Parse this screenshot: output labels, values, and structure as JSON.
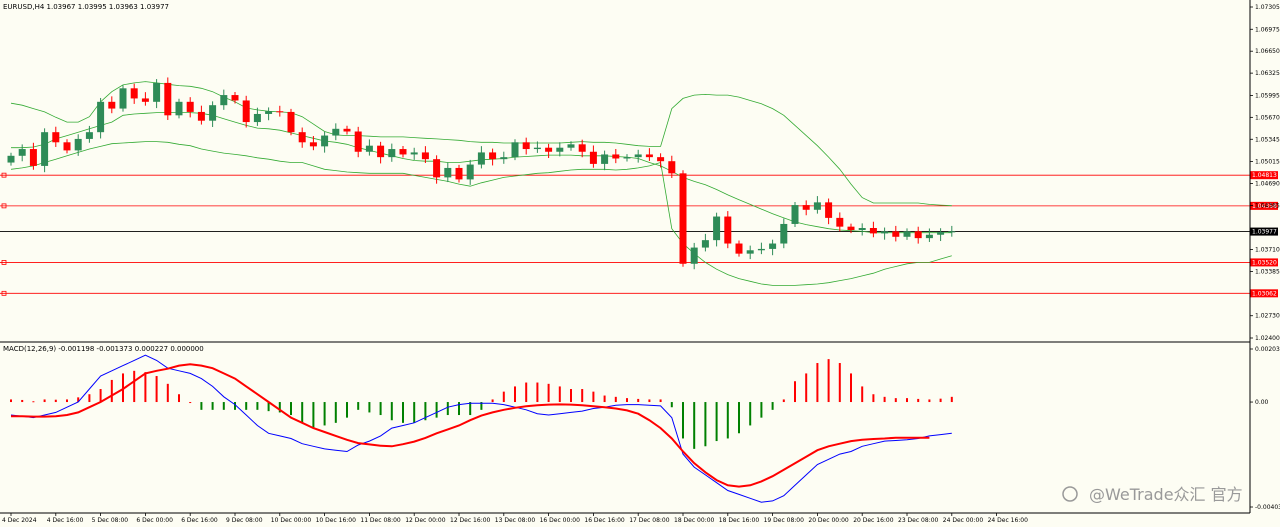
{
  "chart_data": [
    {
      "type": "candlestick",
      "symbol_header": "EURUSD,H4  1.03967 1.03995 1.03963 1.03977",
      "indicator": "Bollinger Bands",
      "ylim": [
        1.024,
        1.07305
      ],
      "y_ticks": [
        "1.07305",
        "1.06975",
        "1.06650",
        "1.06325",
        "1.05995",
        "1.05670",
        "1.05345",
        "1.05015",
        "1.04690",
        "1.04365",
        "1.03710",
        "1.03385",
        "1.02730",
        "1.02400"
      ],
      "x_ticks": [
        "4 Dec 2024",
        "4 Dec 16:00",
        "5 Dec 08:00",
        "6 Dec 00:00",
        "6 Dec 16:00",
        "9 Dec 08:00",
        "10 Dec 00:00",
        "10 Dec 16:00",
        "11 Dec 08:00",
        "12 Dec 00:00",
        "12 Dec 16:00",
        "13 Dec 08:00",
        "16 Dec 00:00",
        "16 Dec 16:00",
        "17 Dec 08:00",
        "18 Dec 00:00",
        "18 Dec 16:00",
        "19 Dec 08:00",
        "20 Dec 00:00",
        "20 Dec 16:00",
        "23 Dec 08:00",
        "24 Dec 00:00",
        "24 Dec 16:00"
      ],
      "current_price": "1.03977",
      "levels": [
        {
          "label": "1.04813",
          "value": 1.04813
        },
        {
          "label": "1.04358",
          "value": 1.04358
        },
        {
          "label": "1.03520",
          "value": 1.0352
        },
        {
          "label": "1.03062",
          "value": 1.03062
        }
      ],
      "colors": {
        "bull": "#2e8b57",
        "bear": "#ff0000",
        "band": "#33aa33",
        "level": "#ff0000",
        "current": "#000000"
      },
      "close": [
        1.051,
        1.052,
        1.0495,
        1.0545,
        1.053,
        1.0518,
        1.0535,
        1.0545,
        1.059,
        1.058,
        1.061,
        1.0595,
        1.059,
        1.0618,
        1.057,
        1.059,
        1.0575,
        1.0562,
        1.0585,
        1.06,
        1.0592,
        1.056,
        1.0572,
        1.0576,
        1.0575,
        1.0545,
        1.053,
        1.0524,
        1.054,
        1.055,
        1.0546,
        1.0516,
        1.0525,
        1.0508,
        1.052,
        1.0512,
        1.0515,
        1.0505,
        1.0478,
        1.0492,
        1.0475,
        1.0497,
        1.0515,
        1.0505,
        1.0508,
        1.053,
        1.052,
        1.0522,
        1.0516,
        1.0522,
        1.0527,
        1.0516,
        1.0498,
        1.0512,
        1.0506,
        1.0508,
        1.0512,
        1.0508,
        1.0502,
        1.0484,
        1.035,
        1.0374,
        1.0385,
        1.042,
        1.038,
        1.0365,
        1.037,
        1.0372,
        1.038,
        1.0409,
        1.0437,
        1.043,
        1.0441,
        1.0418,
        1.0405,
        1.04,
        1.0403,
        1.0395,
        1.0398,
        1.039,
        1.0398,
        1.0388,
        1.0393,
        1.0397,
        1.0398
      ],
      "bb_upper": [
        1.0588,
        1.0585,
        1.058,
        1.0575,
        1.0567,
        1.056,
        1.056,
        1.0568,
        1.059,
        1.0605,
        1.0615,
        1.0618,
        1.062,
        1.0618,
        1.0616,
        1.0614,
        1.0613,
        1.061,
        1.0605,
        1.0597,
        1.059,
        1.0581,
        1.0578,
        1.0576,
        1.0575,
        1.0574,
        1.0568,
        1.0557,
        1.0546,
        1.0541,
        1.054,
        1.054,
        1.0539,
        1.0538,
        1.0538,
        1.0538,
        1.0537,
        1.0536,
        1.0535,
        1.0534,
        1.0533,
        1.0531,
        1.053,
        1.053,
        1.0529,
        1.0529,
        1.0529,
        1.0529,
        1.0529,
        1.0529,
        1.053,
        1.0531,
        1.053,
        1.053,
        1.0529,
        1.0527,
        1.0525,
        1.0524,
        1.0524,
        1.058,
        1.0595,
        1.06,
        1.0601,
        1.06,
        1.06,
        1.0597,
        1.0592,
        1.0587,
        1.058,
        1.057,
        1.0555,
        1.054,
        1.0525,
        1.0508,
        1.049,
        1.0468,
        1.0448,
        1.044,
        1.044,
        1.044,
        1.044,
        1.044,
        1.0438,
        1.0437,
        1.0436
      ],
      "bb_middle": [
        1.0522,
        1.0522,
        1.0523,
        1.0527,
        1.0535,
        1.054,
        1.0545,
        1.055,
        1.0555,
        1.056,
        1.057,
        1.0572,
        1.0573,
        1.0574,
        1.0574,
        1.0574,
        1.0574,
        1.0573,
        1.057,
        1.0565,
        1.056,
        1.0555,
        1.0551,
        1.055,
        1.0548,
        1.0544,
        1.054,
        1.0536,
        1.0532,
        1.053,
        1.0527,
        1.0522,
        1.0518,
        1.0514,
        1.051,
        1.0506,
        1.0503,
        1.0502,
        1.0502,
        1.05,
        1.05,
        1.0502,
        1.0504,
        1.0505,
        1.0506,
        1.0508,
        1.0509,
        1.051,
        1.0511,
        1.0511,
        1.0511,
        1.051,
        1.051,
        1.051,
        1.0509,
        1.0508,
        1.0506,
        1.05,
        1.0495,
        1.0487,
        1.0478,
        1.0472,
        1.0467,
        1.046,
        1.0452,
        1.0445,
        1.0438,
        1.0431,
        1.0424,
        1.0418,
        1.0412,
        1.0408,
        1.0405,
        1.0402,
        1.04,
        1.0399,
        1.0398,
        1.0396,
        1.0396,
        1.0396,
        1.0396,
        1.0396,
        1.0396,
        1.0396,
        1.0396
      ],
      "bb_lower": [
        1.049,
        1.0492,
        1.0495,
        1.05,
        1.0505,
        1.051,
        1.0515,
        1.052,
        1.0524,
        1.0528,
        1.0529,
        1.053,
        1.0531,
        1.0531,
        1.053,
        1.0527,
        1.0525,
        1.052,
        1.0517,
        1.0514,
        1.0512,
        1.051,
        1.0507,
        1.0505,
        1.0502,
        1.05,
        1.05,
        1.0495,
        1.049,
        1.0488,
        1.0486,
        1.0485,
        1.0484,
        1.0484,
        1.0484,
        1.0484,
        1.0481,
        1.0478,
        1.0475,
        1.0472,
        1.0468,
        1.0465,
        1.047,
        1.0474,
        1.0478,
        1.048,
        1.0482,
        1.0484,
        1.0485,
        1.0487,
        1.0489,
        1.049,
        1.049,
        1.049,
        1.0489,
        1.049,
        1.0492,
        1.0495,
        1.05,
        1.0402,
        1.038,
        1.0365,
        1.0352,
        1.0342,
        1.0334,
        1.0328,
        1.0324,
        1.032,
        1.0318,
        1.0318,
        1.0318,
        1.0319,
        1.032,
        1.0322,
        1.0325,
        1.0328,
        1.0332,
        1.0336,
        1.0342,
        1.0346,
        1.035,
        1.0352,
        1.0352,
        1.0357,
        1.0362
      ]
    },
    {
      "type": "macd",
      "header": "MACD(12,26,9) -0.001198 -0.001373 0.000227 0.000000",
      "ylim": [
        -0.004035,
        0.002039
      ],
      "y_ticks": [
        "0.002039",
        "0.00",
        "-0.004035"
      ],
      "colors": {
        "hist_pos": "#ff0000",
        "hist_neg": "#008000",
        "main": "#0000ff",
        "signal": "#ff0000"
      },
      "histogram": [
        0.0001,
        8e-05,
        3e-05,
        0.0001,
        9e-05,
        0.0001,
        0.00018,
        0.0003,
        0.0005,
        0.00085,
        0.0011,
        0.0012,
        0.00115,
        0.001,
        0.0007,
        0.0003,
        0.0,
        -0.0003,
        -0.0003,
        -0.0003,
        -0.0003,
        -0.0003,
        -0.0003,
        -0.00035,
        -0.0004,
        -0.0005,
        -0.0008,
        -0.001,
        -0.0009,
        -0.0008,
        -0.0006,
        -0.0003,
        -0.0004,
        -0.0005,
        -0.0007,
        -0.0008,
        -0.0008,
        -0.0007,
        -0.0006,
        -0.0005,
        -0.0005,
        -0.0005,
        -0.0003,
        0.0001,
        0.0004,
        0.0006,
        0.00075,
        0.00075,
        0.0007,
        0.0006,
        0.0005,
        0.0005,
        0.0004,
        0.00025,
        0.0002,
        0.00015,
        0.00012,
        0.0001,
        0.0001,
        -0.0002,
        -0.0014,
        -0.0018,
        -0.0017,
        -0.0015,
        -0.0014,
        -0.0012,
        -0.0009,
        -0.0006,
        -0.0003,
        0.0001,
        0.0008,
        0.0011,
        0.0015,
        0.00165,
        0.0015,
        0.0011,
        0.0006,
        0.0003,
        0.0002,
        0.00015,
        0.00015,
        0.00012,
        0.0001,
        0.00013,
        0.0002
      ],
      "macd_main": [
        -0.0005,
        -0.00055,
        -0.0006,
        -0.0005,
        -0.0004,
        -0.0002,
        0.0,
        0.0005,
        0.001,
        0.0012,
        0.0014,
        0.0016,
        0.0018,
        0.0016,
        0.0013,
        0.0012,
        0.0011,
        0.0009,
        0.0006,
        0.0002,
        -0.0001,
        -0.0005,
        -0.0009,
        -0.0012,
        -0.0013,
        -0.0014,
        -0.0016,
        -0.0017,
        -0.0018,
        -0.00185,
        -0.0019,
        -0.00165,
        -0.0015,
        -0.0013,
        -0.001,
        -0.0009,
        -0.0008,
        -0.0006,
        -0.0004,
        -0.0002,
        -0.0001,
        -5e-05,
        -5e-05,
        -5e-05,
        -0.0001,
        -0.0002,
        -0.0003,
        -0.00045,
        -0.0005,
        -0.00045,
        -0.0004,
        -0.00035,
        -0.00025,
        -0.0002,
        -0.00012,
        -0.0001,
        -0.0001,
        -0.00012,
        -0.00015,
        -0.0006,
        -0.002,
        -0.0025,
        -0.0028,
        -0.0031,
        -0.0034,
        -0.00355,
        -0.0037,
        -0.00385,
        -0.0038,
        -0.0036,
        -0.0032,
        -0.0028,
        -0.0024,
        -0.0022,
        -0.002,
        -0.0019,
        -0.0017,
        -0.0016,
        -0.0015,
        -0.00148,
        -0.00145,
        -0.0014,
        -0.0013,
        -0.00125,
        -0.0012
      ],
      "macd_signal": [
        -0.00055,
        -0.00055,
        -0.00056,
        -0.00056,
        -0.00055,
        -0.0005,
        -0.0004,
        -0.0002,
        0.0,
        0.00025,
        0.0005,
        0.0008,
        0.0011,
        0.0012,
        0.00128,
        0.0014,
        0.00145,
        0.0014,
        0.0013,
        0.0011,
        0.0009,
        0.0006,
        0.0003,
        0.0,
        -0.0003,
        -0.0006,
        -0.0008,
        -0.001,
        -0.00115,
        -0.0013,
        -0.00145,
        -0.00158,
        -0.00163,
        -0.00168,
        -0.0017,
        -0.00162,
        -0.00152,
        -0.00138,
        -0.0012,
        -0.00105,
        -0.0009,
        -0.0007,
        -0.00052,
        -0.0004,
        -0.0003,
        -0.00022,
        -0.00016,
        -0.00012,
        -0.0001,
        -9e-05,
        -0.0001,
        -0.00012,
        -0.00016,
        -0.0002,
        -0.00025,
        -0.00032,
        -0.00045,
        -0.0007,
        -0.001,
        -0.0014,
        -0.0019,
        -0.00235,
        -0.0027,
        -0.003,
        -0.0032,
        -0.00325,
        -0.0032,
        -0.00305,
        -0.00285,
        -0.0026,
        -0.00235,
        -0.0021,
        -0.00185,
        -0.0017,
        -0.0016,
        -0.0015,
        -0.00145,
        -0.00142,
        -0.0014,
        -0.00137,
        -0.00137,
        -0.00137,
        -0.00137
      ]
    }
  ],
  "watermark": "@WeTrade众汇 官方"
}
